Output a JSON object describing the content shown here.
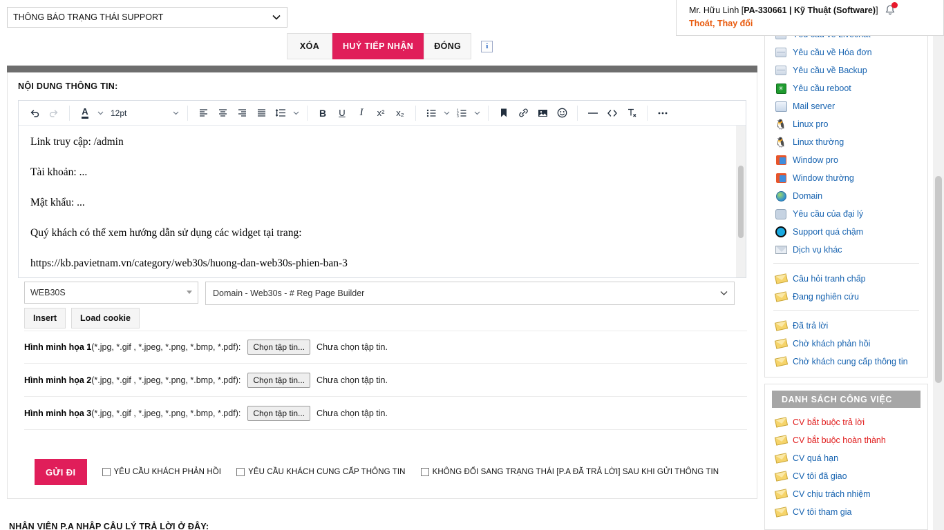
{
  "header": {
    "status_select": {
      "value": "THÔNG BÁO TRẠNG THÁI SUPPORT",
      "options": [
        "THÔNG BÁO TRẠNG THÁI SUPPORT"
      ]
    },
    "actions": {
      "delete_label": "XÓA",
      "cancel_receive_label": "HUỶ TIẾP NHẬN",
      "close_label": "ĐÓNG",
      "info_label": "i"
    },
    "accent_pink": "#e01e5a"
  },
  "user": {
    "name_prefix": "Mr. Hữu Linh [",
    "code": "PA-330661 | Kỹ Thuật (Software)",
    "name_suffix": "]",
    "logout_label": "Thoát",
    "separator": ", ",
    "change_label": "Thay đổi",
    "bell_icon": "bell-icon",
    "orange": "#e8590c"
  },
  "panel": {
    "title": "NỘI DUNG THÔNG TIN:",
    "editor": {
      "toolbar": {
        "undo": "↶",
        "redo": "↷",
        "font_color": "A",
        "font_size": "12pt",
        "align_left": "align-left",
        "align_center": "align-center",
        "align_right": "align-right",
        "align_justify": "align-justify",
        "line_height": "line-height",
        "bold": "B",
        "underline": "U",
        "italic": "I",
        "superscript": "x²",
        "subscript": "x₂",
        "bullet_list": "bullet-list",
        "number_list": "number-list",
        "bookmark": "bookmark",
        "link": "link",
        "image": "image",
        "emoji": "emoji",
        "hr": "—",
        "source_code": "<>",
        "clear_format": "clear-format",
        "more": "•••"
      },
      "content": [
        "Link truy cập: /admin",
        "Tài khoản: ...",
        "Mật khẩu: ...",
        "Quý khách có thể xem hướng dẫn sử dụng các widget tại trang:",
        "https://kb.pavietnam.vn/category/web30s/huong-dan-web30s-phien-ban-3"
      ]
    },
    "product_select": {
      "value": "WEB30S",
      "options": [
        "WEB30S"
      ]
    },
    "template_select": {
      "value": "Domain - Web30s - # Reg Page Builder",
      "options": [
        "Domain - Web30s - # Reg Page Builder"
      ]
    },
    "insert_label": "Insert",
    "load_cookie_label": "Load cookie",
    "file_rows": [
      {
        "label": "Hình minh họa 1",
        "exts": "(*.jpg, *.gif , *.jpeg, *.png, *.bmp, *.pdf):",
        "button": "Chọn tập tin...",
        "status": "Chưa chọn tập tin."
      },
      {
        "label": "Hình minh họa 2",
        "exts": "(*.jpg, *.gif , *.jpeg, *.png, *.bmp, *.pdf):",
        "button": "Chọn tập tin...",
        "status": "Chưa chọn tập tin."
      },
      {
        "label": "Hình minh họa 3",
        "exts": "(*.jpg, *.gif , *.jpeg, *.png, *.bmp, *.pdf):",
        "button": "Chọn tập tin...",
        "status": "Chưa chọn tập tin."
      }
    ],
    "submit_label": "GỬI ĐI",
    "checkboxes": [
      {
        "label": "YÊU CẦU KHÁCH PHẢN HỒI",
        "checked": false
      },
      {
        "label": "YÊU CẦU KHÁCH CUNG CẤP THÔNG TIN",
        "checked": false
      },
      {
        "label": "KHÔNG ĐỔI SANG TRẠNG THÁI [P.A ĐÃ TRẢ LỜI] SAU KHI GỬI THÔNG TIN",
        "checked": false
      }
    ]
  },
  "footer": {
    "text": "NHÂN VIÊN P.A NHẬP CÂU LÝ TRẢ LỜI Ở ĐÂY:"
  },
  "sidebar": {
    "group1": [
      {
        "label": "Yêu cầu về Livechat",
        "icon": "server-icon",
        "color": "link"
      },
      {
        "label": "Yêu cầu về Hóa đơn",
        "icon": "server-icon",
        "color": "link"
      },
      {
        "label": "Yêu cầu về Backup",
        "icon": "server-icon",
        "color": "link"
      },
      {
        "label": "Yêu cầu reboot",
        "icon": "reboot-icon",
        "color": "link"
      },
      {
        "label": "Mail server",
        "icon": "mail-server-icon",
        "color": "link"
      },
      {
        "label": "Linux pro",
        "icon": "penguin-icon",
        "color": "link"
      },
      {
        "label": "Linux thường",
        "icon": "penguin-icon",
        "color": "link"
      },
      {
        "label": "Window pro",
        "icon": "windows-icon",
        "color": "link"
      },
      {
        "label": "Window thường",
        "icon": "windows-icon",
        "color": "link"
      },
      {
        "label": "Domain",
        "icon": "globe-icon",
        "color": "link"
      },
      {
        "label": "Yêu cầu của đại lý",
        "icon": "hex-icon",
        "color": "link"
      },
      {
        "label": "Support quá chậm",
        "icon": "clock-icon",
        "color": "link"
      },
      {
        "label": "Dịch vụ khác",
        "icon": "envelope-icon",
        "color": "link"
      }
    ],
    "group2": [
      {
        "label": "Câu hỏi tranh chấp",
        "icon": "yellow-envelope-icon",
        "color": "link"
      },
      {
        "label": "Đang nghiên cứu",
        "icon": "yellow-envelope-icon",
        "color": "link"
      }
    ],
    "group3": [
      {
        "label": "Đã trả lời",
        "icon": "yellow-envelope-icon",
        "color": "link"
      },
      {
        "label": "Chờ khách phản hồi",
        "icon": "yellow-envelope-icon",
        "color": "link"
      },
      {
        "label": "Chờ khách cung cấp thông tin",
        "icon": "yellow-envelope-icon",
        "color": "link"
      }
    ],
    "tasks": {
      "title": "DANH SÁCH CÔNG VIỆC",
      "items": [
        {
          "label": "CV bắt buộc trả lời",
          "icon": "yellow-envelope-icon",
          "color": "red"
        },
        {
          "label": "CV bắt buộc hoàn thành",
          "icon": "yellow-envelope-icon",
          "color": "red"
        },
        {
          "label": "CV quá hạn",
          "icon": "yellow-envelope-icon",
          "color": "link"
        },
        {
          "label": "CV tôi đã giao",
          "icon": "yellow-envelope-icon",
          "color": "link"
        },
        {
          "label": "CV chịu trách nhiệm",
          "icon": "yellow-envelope-icon",
          "color": "link"
        },
        {
          "label": "CV tôi tham gia",
          "icon": "yellow-envelope-icon",
          "color": "link"
        }
      ]
    }
  }
}
